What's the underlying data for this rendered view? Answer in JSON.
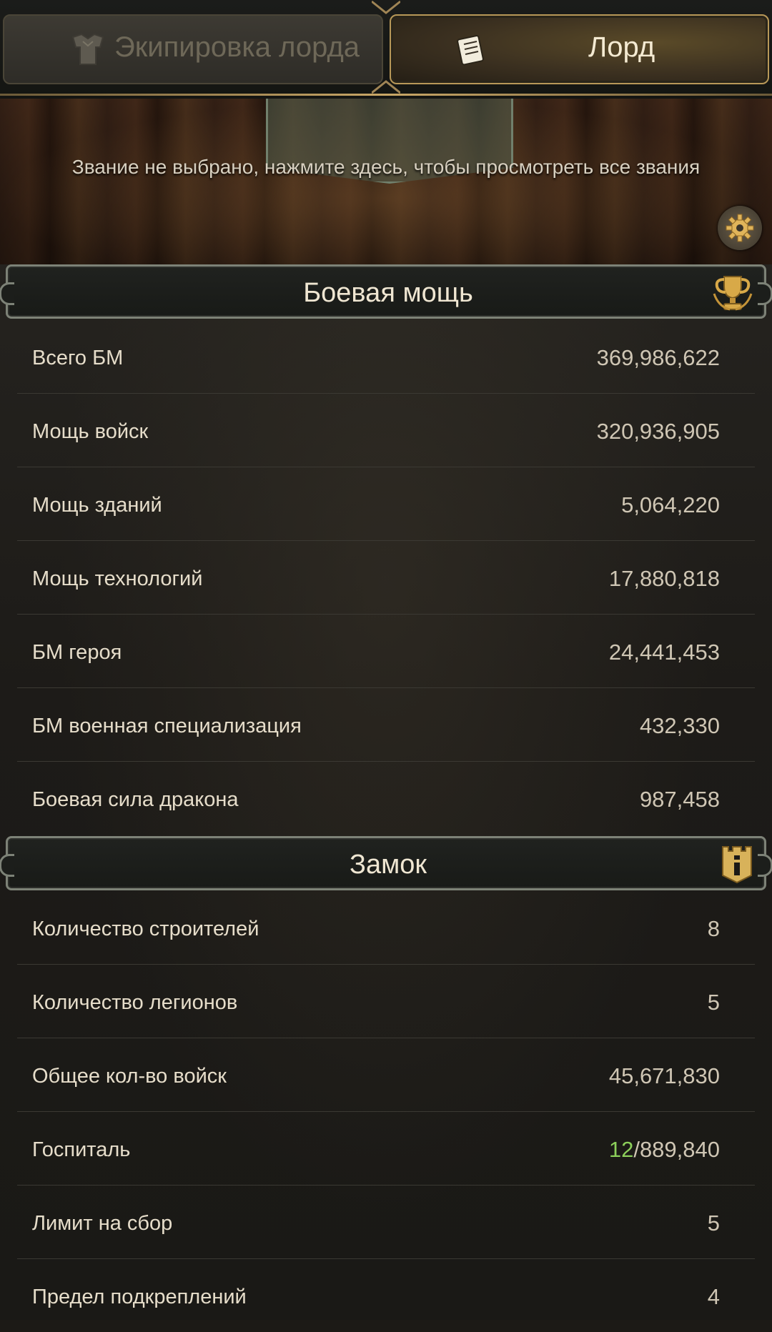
{
  "tabs": [
    {
      "label": "Экипировка лорда",
      "icon": "armor-icon",
      "active": false
    },
    {
      "label": "Лорд",
      "icon": "scroll-icon",
      "active": true
    }
  ],
  "banner": {
    "text": "Звание не выбрано, нажмите здесь, чтобы просмотреть все звания",
    "settings_icon": "gear-icon"
  },
  "combat_section": {
    "title": "Боевая мощь",
    "icon": "trophy-icon",
    "rows": [
      {
        "label": "Всего БМ",
        "value": "369,986,622"
      },
      {
        "label": "Мощь войск",
        "value": "320,936,905"
      },
      {
        "label": "Мощь зданий",
        "value": "5,064,220"
      },
      {
        "label": "Мощь технологий",
        "value": "17,880,818"
      },
      {
        "label": "БМ героя",
        "value": "24,441,453"
      },
      {
        "label": "БМ военная специализация",
        "value": "432,330"
      },
      {
        "label": "Боевая сила дракона",
        "value": "987,458"
      }
    ]
  },
  "castle_section": {
    "title": "Замок",
    "icon": "castle-tower-icon",
    "rows": [
      {
        "label": "Количество строителей",
        "value": "8"
      },
      {
        "label": "Количество легионов",
        "value": "5"
      },
      {
        "label": "Общее кол-во войск",
        "value": "45,671,830"
      },
      {
        "label": "Госпиталь",
        "value_current": "12",
        "value_max": "/889,840"
      },
      {
        "label": "Лимит на сбор",
        "value": "5"
      },
      {
        "label": "Предел подкреплений",
        "value": "4"
      }
    ]
  },
  "colors": {
    "highlight_green": "#8ccf5a",
    "gold_accent": "#c9a766"
  }
}
